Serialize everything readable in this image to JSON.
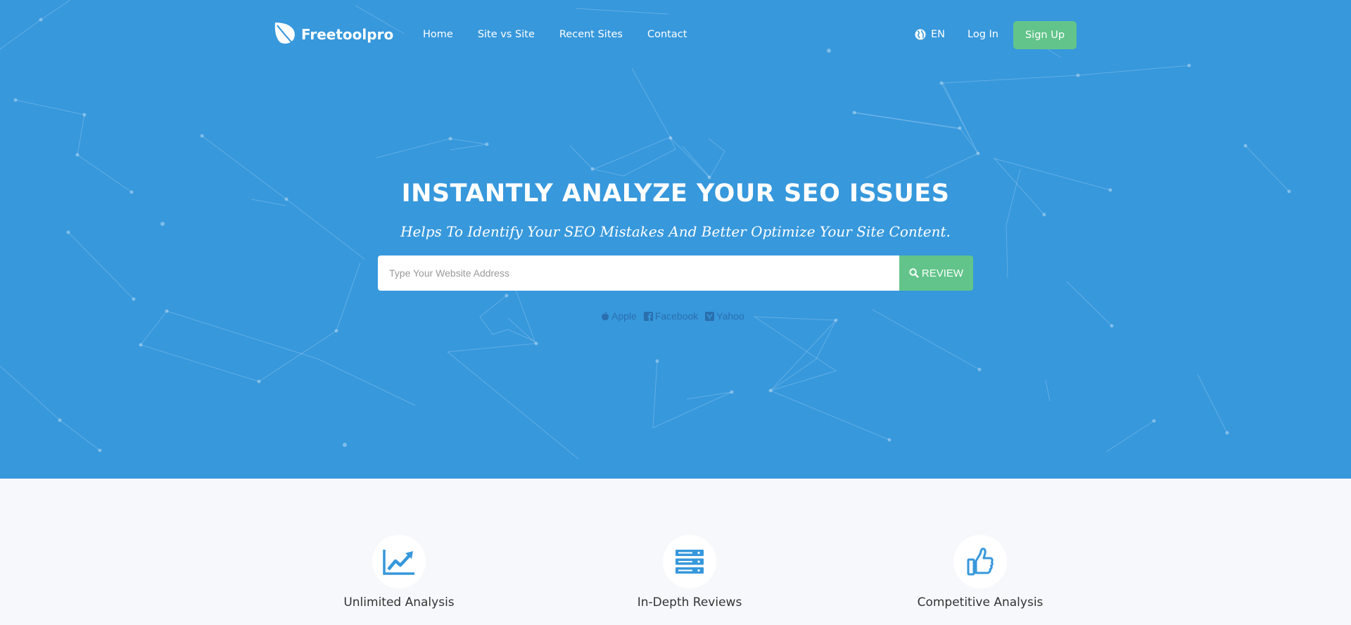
{
  "header": {
    "brand": "Freetoolpro",
    "nav": [
      "Home",
      "Site vs Site",
      "Recent Sites",
      "Contact"
    ],
    "language": "EN",
    "login_label": "Log In",
    "signup_label": "Sign Up"
  },
  "hero": {
    "title": "INSTANTLY ANALYZE YOUR SEO ISSUES",
    "subtitle": "Helps To Identify Your SEO Mistakes And Better Optimize Your Site Content.",
    "search_placeholder": "Type Your Website Address",
    "review_label": "REVIEW",
    "examples": [
      "Apple",
      "Facebook",
      "Yahoo"
    ]
  },
  "features": [
    {
      "label": "Unlimited Analysis",
      "icon": "line-chart-icon"
    },
    {
      "label": "In-Depth Reviews",
      "icon": "server-icon"
    },
    {
      "label": "Competitive Analysis",
      "icon": "thumbs-up-icon"
    }
  ],
  "colors": {
    "hero_bg": "#3798dc",
    "accent_green": "#62c48a",
    "icon_blue": "#3798dc",
    "section_bg": "#f6f8fb"
  }
}
